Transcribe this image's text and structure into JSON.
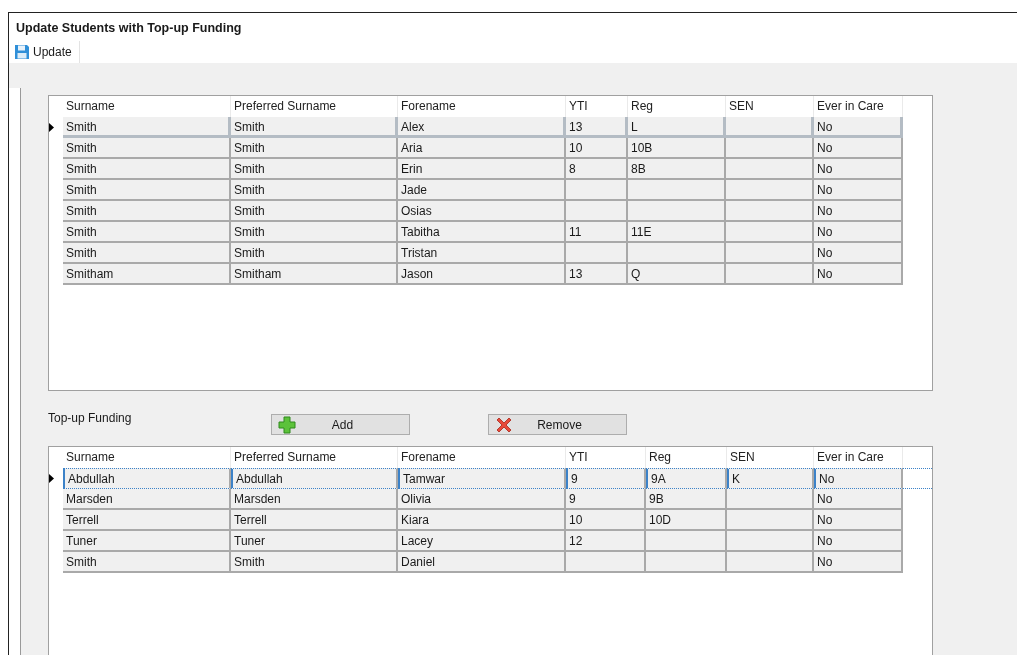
{
  "window": {
    "title": "Update Students with Top-up Funding"
  },
  "toolbar": [
    {
      "label": "Update"
    }
  ],
  "students_grid": {
    "focused": false,
    "columns": [
      "Surname",
      "Preferred Surname",
      "Forename",
      "YTI",
      "Reg",
      "SEN",
      "Ever in Care"
    ],
    "rows": [
      {
        "selected": true,
        "cells": [
          "Smith",
          "Smith",
          "Alex",
          "13",
          "L",
          "",
          "No"
        ]
      },
      {
        "selected": false,
        "cells": [
          "Smith",
          "Smith",
          "Aria",
          "10",
          "10B",
          "",
          "No"
        ]
      },
      {
        "selected": false,
        "cells": [
          "Smith",
          "Smith",
          "Erin",
          "8",
          "8B",
          "",
          "No"
        ]
      },
      {
        "selected": false,
        "cells": [
          "Smith",
          "Smith",
          "Jade",
          "",
          "",
          "",
          "No"
        ]
      },
      {
        "selected": false,
        "cells": [
          "Smith",
          "Smith",
          "Osias",
          "",
          "",
          "",
          "No"
        ]
      },
      {
        "selected": false,
        "cells": [
          "Smith",
          "Smith",
          "Tabitha",
          "11",
          "11E",
          "",
          "No"
        ]
      },
      {
        "selected": false,
        "cells": [
          "Smith",
          "Smith",
          "Tristan",
          "",
          "",
          "",
          "No"
        ]
      },
      {
        "selected": false,
        "cells": [
          "Smitham",
          "Smitham",
          "Jason",
          "13",
          "Q",
          "",
          "No"
        ]
      }
    ]
  },
  "topup": {
    "label": "Top-up Funding",
    "buttons": [
      {
        "kind": "add",
        "label": "Add"
      },
      {
        "kind": "remove",
        "label": "Remove"
      }
    ],
    "grid": {
      "focused": true,
      "columns": [
        "Surname",
        "Preferred Surname",
        "Forename",
        "YTI",
        "Reg",
        "SEN",
        "Ever in Care"
      ],
      "rows": [
        {
          "selected": true,
          "cells": [
            "Abdullah",
            "Abdullah",
            "Tamwar",
            "9",
            "9A",
            "K",
            "No"
          ]
        },
        {
          "selected": false,
          "cells": [
            "Marsden",
            "Marsden",
            "Olivia",
            "9",
            "9B",
            "",
            "No"
          ]
        },
        {
          "selected": false,
          "cells": [
            "Terrell",
            "Terrell",
            "Kiara",
            "10",
            "10D",
            "",
            "No"
          ]
        },
        {
          "selected": false,
          "cells": [
            "Tuner",
            "Tuner",
            "Lacey",
            "12",
            "",
            "",
            "No"
          ]
        },
        {
          "selected": false,
          "cells": [
            "Smith",
            "Smith",
            "Daniel",
            "",
            "",
            "",
            "No"
          ]
        }
      ]
    }
  }
}
